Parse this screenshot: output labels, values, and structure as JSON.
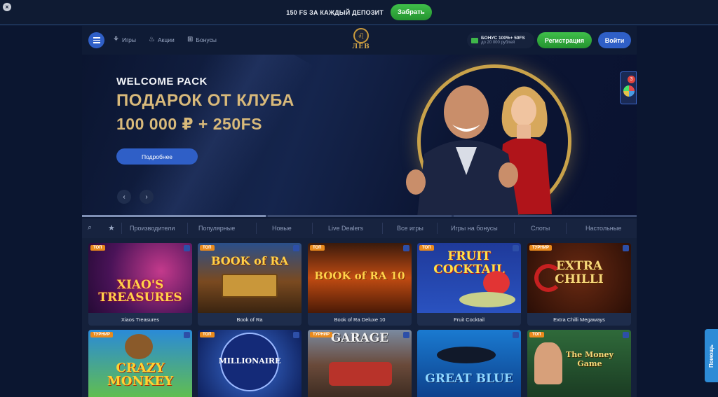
{
  "promo": {
    "text": "150 FS ЗА КАЖДЫЙ ДЕПОЗИТ",
    "button": "Забрать"
  },
  "header": {
    "nav": [
      {
        "label": "Игры",
        "icon": "games-icon"
      },
      {
        "label": "Акции",
        "icon": "fire-icon"
      },
      {
        "label": "Бонусы",
        "icon": "gift-icon"
      }
    ],
    "logo_text": "ЛЕВ",
    "bonus": {
      "main": "БОНУС 100%+ 50FS",
      "sub": "до 20 000 рублей"
    },
    "register": "Регистрация",
    "login": "Войти"
  },
  "hero": {
    "kicker": "WELCOME PACK",
    "title": "ПОДАРОК ОТ КЛУБА",
    "subtitle": "100 000 ₽ + 250FS",
    "button": "Подробнее",
    "widget_badge": "3"
  },
  "categories": [
    "Производители",
    "Популярные",
    "Новые",
    "Live Dealers",
    "Все игры",
    "Игры на бонусы",
    "Слоты",
    "Настольные"
  ],
  "games": [
    {
      "name": "Xiaos Treasures",
      "tag": "ТОП",
      "art": "XIAO'S\nTREASURES"
    },
    {
      "name": "Book of Ra",
      "tag": "ТОП",
      "art": "BOOK of RA"
    },
    {
      "name": "Book of Ra Deluxe 10",
      "tag": "ТОП",
      "art": "BOOK of RA 10"
    },
    {
      "name": "Fruit Cocktail",
      "tag": "ТОП",
      "art": "FRUIT COCKTAIL"
    },
    {
      "name": "Extra Chilli Megaways",
      "tag": "ТУРНИР",
      "art": "EXTRA CHILLI"
    },
    {
      "name": "",
      "tag": "ТУРНИР",
      "art": "CRAZY MONKEY"
    },
    {
      "name": "",
      "tag": "ТОП",
      "art": "MILLIONAIRE"
    },
    {
      "name": "",
      "tag": "ТУРНИР",
      "art": "GARAGE"
    },
    {
      "name": "",
      "tag": "",
      "art": "GREAT BLUE"
    },
    {
      "name": "",
      "tag": "ТОП",
      "art": "The Money Game"
    }
  ],
  "help": "Помощь"
}
